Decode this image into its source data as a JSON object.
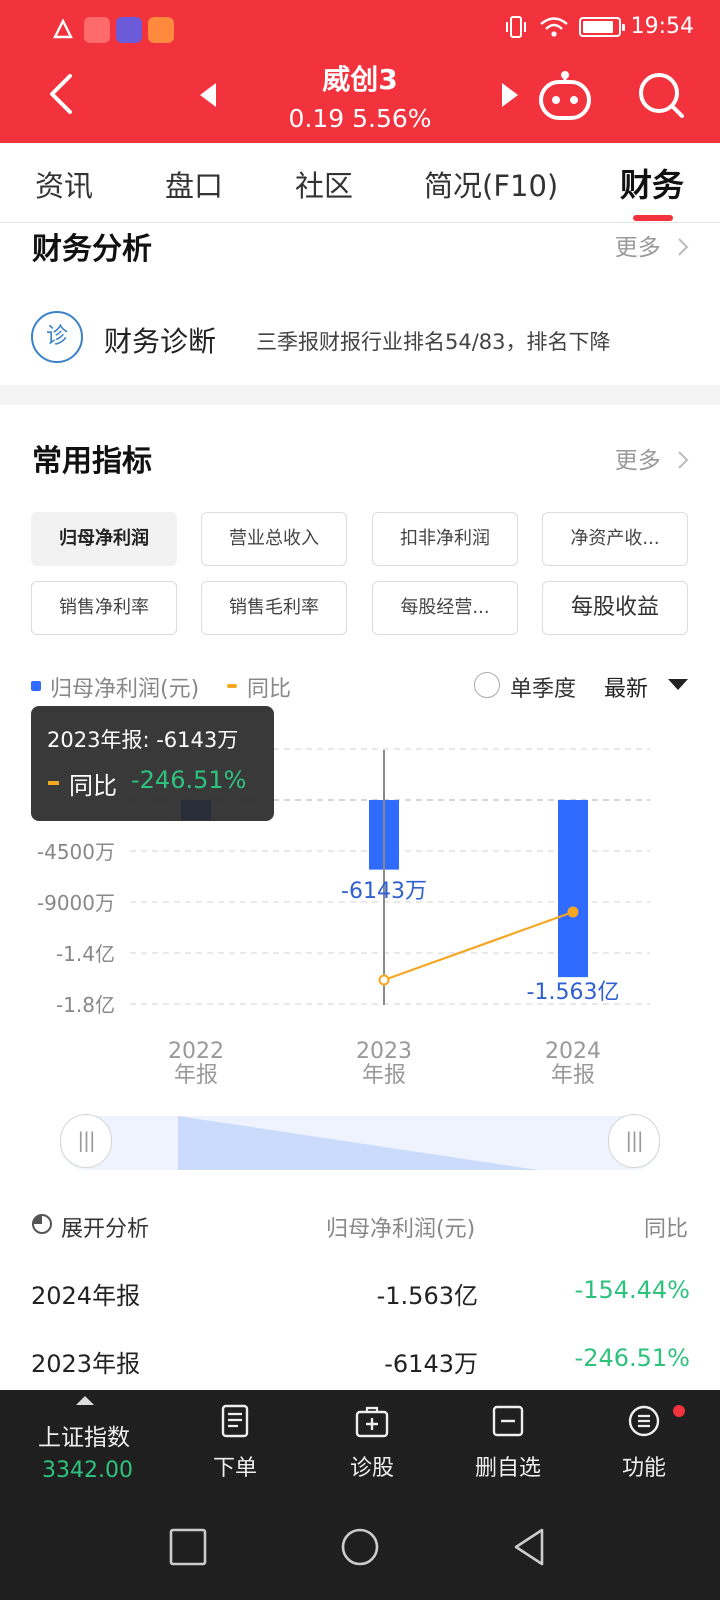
{
  "status": {
    "time": "19:54"
  },
  "header": {
    "title": "威创3",
    "price": "0.19",
    "change": "5.56%"
  },
  "tabs": [
    {
      "label": "资讯",
      "active": false
    },
    {
      "label": "盘口",
      "active": false
    },
    {
      "label": "社区",
      "active": false
    },
    {
      "label": "简况(F10)",
      "active": false
    },
    {
      "label": "财务",
      "active": true
    }
  ],
  "finance_analysis": {
    "title": "财务分析",
    "more": "更多",
    "diagnosis_icon": "诊",
    "diagnosis_label": "财务诊断",
    "diagnosis_text": "三季报财报行业排名54/83，排名下降"
  },
  "common_indicators": {
    "title": "常用指标",
    "more": "更多",
    "buttons": [
      {
        "label": "归母净利润",
        "active": true
      },
      {
        "label": "营业总收入",
        "active": false
      },
      {
        "label": "扣非净利润",
        "active": false
      },
      {
        "label": "净资产收...",
        "active": false
      },
      {
        "label": "销售净利率",
        "active": false
      },
      {
        "label": "销售毛利率",
        "active": false
      },
      {
        "label": "每股经营...",
        "active": false
      },
      {
        "label": "每股收益",
        "active": false
      }
    ]
  },
  "legend": {
    "series1": "归母净利润(元)",
    "series2": "同比",
    "single_quarter": "单季度",
    "sort": "最新"
  },
  "colors": {
    "brand_red": "#f2333d",
    "bar_blue": "#2f6bff",
    "line_orange": "#f5a623",
    "green": "#2ec27e"
  },
  "chart_data": {
    "type": "bar",
    "categories": [
      "2022\n年报",
      "2023\n年报",
      "2024\n年报"
    ],
    "series": [
      {
        "name": "归母净利润(元)",
        "values": [
          -1774,
          -6143,
          -15630
        ],
        "unit": "万"
      },
      {
        "name": "同比",
        "values": [
          null,
          -246.51,
          -154.44
        ],
        "unit": "%"
      }
    ],
    "y_ticks": [
      "-4500万",
      "-9000万",
      "-1.4亿",
      "-1.8亿"
    ],
    "y_tick_values": [
      -4500,
      -9000,
      -13500,
      -18000
    ],
    "ylim": [
      -18000,
      4500
    ],
    "data_labels": [
      "",
      "-6143万",
      "-1.563亿"
    ],
    "grid": true,
    "selected_index": 1
  },
  "tooltip": {
    "line1": "2023年报:  -6143万",
    "label": "同比",
    "value": "-246.51%"
  },
  "table": {
    "expand": "展开分析",
    "col_metric": "归母净利润(元)",
    "col_yoy": "同比",
    "rows": [
      {
        "period": "2024年报",
        "value": "-1.563亿",
        "yoy": "-154.44%"
      },
      {
        "period": "2023年报",
        "value": "-6143万",
        "yoy": "-246.51%"
      }
    ]
  },
  "bottom_bar": {
    "index_name": "上证指数",
    "index_value": "3342.00",
    "items": [
      {
        "label": "下单",
        "icon": "order-icon"
      },
      {
        "label": "诊股",
        "icon": "diagnose-icon"
      },
      {
        "label": "删自选",
        "icon": "remove-watchlist-icon"
      },
      {
        "label": "功能",
        "icon": "menu-icon"
      }
    ]
  }
}
